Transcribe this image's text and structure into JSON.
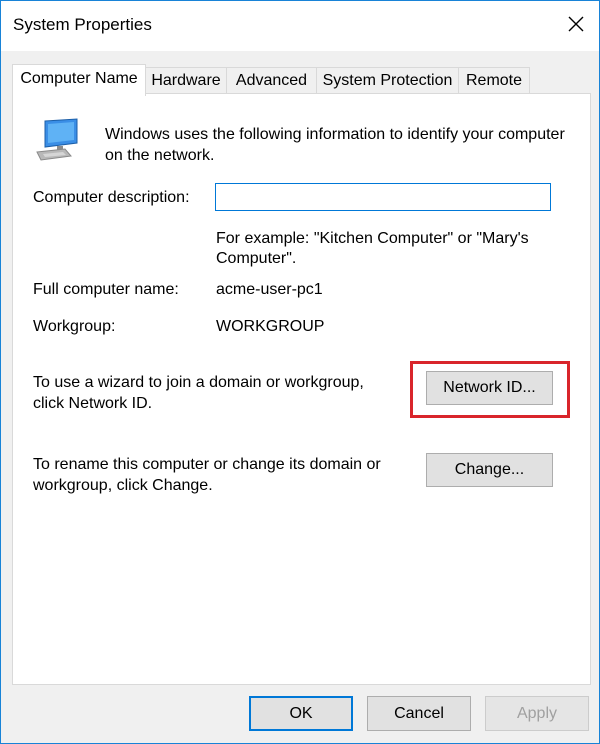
{
  "window": {
    "title": "System Properties",
    "close_glyph": "✕"
  },
  "tabs": [
    {
      "label": "Computer Name",
      "active": true
    },
    {
      "label": "Hardware",
      "active": false
    },
    {
      "label": "Advanced",
      "active": false
    },
    {
      "label": "System Protection",
      "active": false
    },
    {
      "label": "Remote",
      "active": false
    }
  ],
  "panel": {
    "icon": "computer-monitor-icon",
    "intro": "Windows uses the following information to identify your computer on the network.",
    "description_label": "Computer description:",
    "description_value": "",
    "example": "For example: \"Kitchen Computer\" or \"Mary's Computer\".",
    "full_name_label": "Full computer name:",
    "full_name_value": "acme-user-pc1",
    "workgroup_label": "Workgroup:",
    "workgroup_value": "WORKGROUP",
    "network_text": "To use a wizard to join a domain or workgroup, click Network ID.",
    "network_button": "Network ID...",
    "rename_text": "To rename this computer or change its domain or workgroup, click Change.",
    "change_button": "Change..."
  },
  "footer": {
    "ok": "OK",
    "cancel": "Cancel",
    "apply": "Apply"
  },
  "colors": {
    "accent": "#0078d7",
    "highlight": "#d9252b"
  }
}
